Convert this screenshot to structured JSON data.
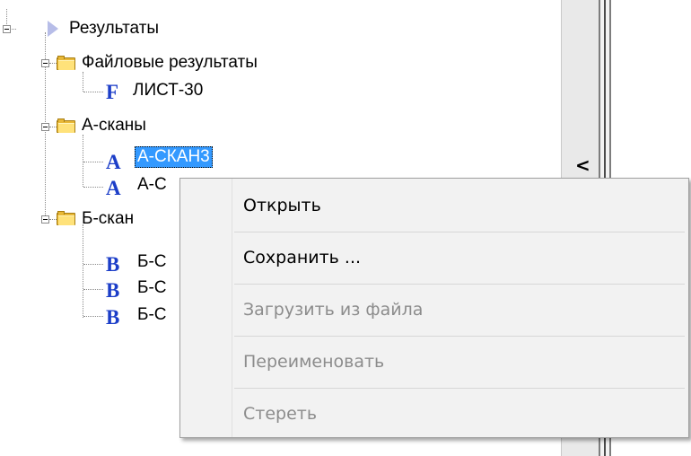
{
  "tree": {
    "root": {
      "label": "Результаты"
    },
    "folder_files": {
      "label": "Файловые результаты"
    },
    "file_item": {
      "letter": "F",
      "label": "ЛИСТ-30"
    },
    "folder_ascans": {
      "label": "А-сканы"
    },
    "ascan_items": [
      {
        "letter": "A",
        "label": "А-СКАН3",
        "selected": true
      },
      {
        "letter": "A",
        "label": "А-С",
        "selected": false
      }
    ],
    "folder_bscans": {
      "label": "Б-скан"
    },
    "bscan_items": [
      {
        "letter": "B",
        "label": "Б-С"
      },
      {
        "letter": "B",
        "label": "Б-С"
      },
      {
        "letter": "B",
        "label": "Б-С"
      }
    ]
  },
  "scroll": {
    "collapse_arrow": "<"
  },
  "context_menu": {
    "items": [
      {
        "label": "Открыть",
        "enabled": true
      },
      {
        "label": "Сохранить ...",
        "enabled": true
      },
      {
        "label": "Загрузить из файла",
        "enabled": false
      },
      {
        "label": "Переименовать",
        "enabled": false
      },
      {
        "label": "Стереть",
        "enabled": false
      }
    ]
  },
  "colors": {
    "selection": "#3399ff",
    "type_letter": "#1c3ec8",
    "folder": "#e8b838",
    "disabled_text": "#8c8c8c"
  }
}
